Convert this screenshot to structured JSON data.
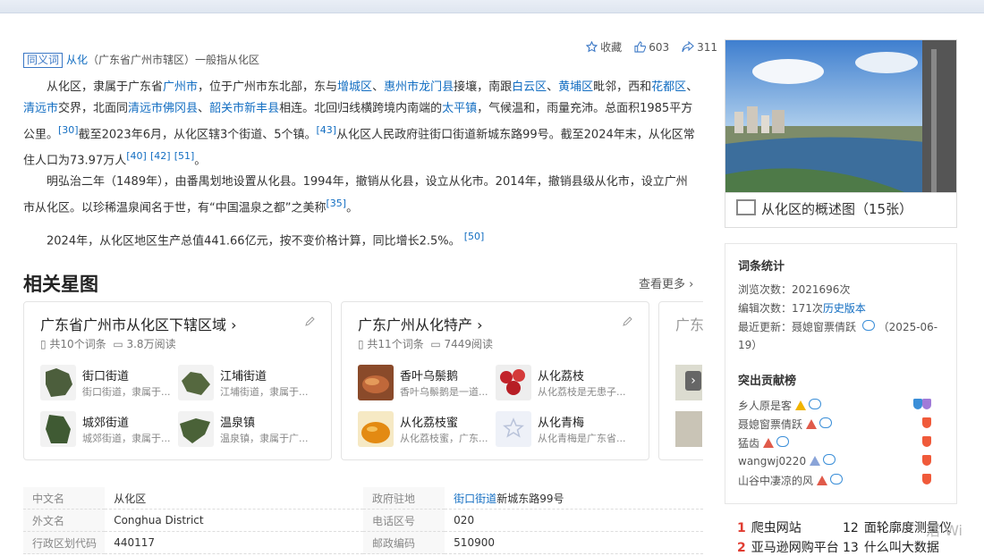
{
  "synonym": {
    "tag": "同义词",
    "link": "从化",
    "rest": "（广东省广州市辖区）一般指从化区"
  },
  "actions": {
    "collect": "收藏",
    "likes": "603",
    "shares": "311"
  },
  "paragraphs": {
    "p1_a": "从化区，隶属于广东省",
    "p1_link1": "广州市",
    "p1_b": "，位于广州市东北部，东与",
    "p1_link2": "增城区",
    "p1_c": "、",
    "p1_link3": "惠州市龙门县",
    "p1_d": "接壤，南跟",
    "p1_link4": "白云区",
    "p1_e": "、",
    "p1_link5": "黄埔区",
    "p1_f": "毗邻，西和",
    "p1_link6": "花都区",
    "p1_g": "、",
    "p1_link7": "清远市",
    "p1_h": "交界，北面同",
    "p1_link8": "清远市佛冈县",
    "p1_i": "、",
    "p1_link9": "韶关市新丰县",
    "p1_j": "相连。北回归线横跨境内南端的",
    "p1_link10": "太平镇",
    "p1_k": "，气候温和，雨量充沛。总面积1985平方公里。",
    "p1_sup1": "[30]",
    "p1_l": "截至2023年6月，从化区辖3个街道、5个镇。",
    "p1_sup2": "[43]",
    "p1_m": "从化区人民政府驻街口街道新城东路99号。截至2024年末，从化区常住人口为73.97万人",
    "p1_sup3": "[40]",
    "p1_sup4": "[42]",
    "p1_sup5": "[51]",
    "p1_n": "。",
    "p2": "明弘治二年（1489年），由番禺划地设置从化县。1994年，撤销从化县，设立从化市。2014年，撤销县级从化市，设立广州市从化区。以珍稀温泉闻名于世，有“中国温泉之都”之美称",
    "p2_sup": "[35]",
    "p2_end": "。",
    "p3": "2024年，从化区地区生产总值441.66亿元，按不变价格计算，同比增长2.5%。",
    "p3_sup": "[50]"
  },
  "star_section": {
    "title": "相关星图",
    "more": "查看更多"
  },
  "cards": [
    {
      "title": "广东省广州市从化区下辖区域",
      "count": "共10个词条",
      "reads": "3.8万阅读",
      "entries": [
        {
          "title": "街口街道",
          "desc": "街口街道，隶属于..."
        },
        {
          "title": "江埔街道",
          "desc": "江埔街道，隶属于..."
        },
        {
          "title": "城郊街道",
          "desc": "城郊街道，隶属于..."
        },
        {
          "title": "温泉镇",
          "desc": "温泉镇，隶属于广..."
        }
      ]
    },
    {
      "title": "广东广州从化特产",
      "count": "共11个词条",
      "reads": "7449阅读",
      "entries": [
        {
          "title": "香叶乌鬃鹅",
          "desc": "香叶乌鬃鹅是一道..."
        },
        {
          "title": "从化荔枝",
          "desc": "从化荔枝是无患子..."
        },
        {
          "title": "从化荔枝蜜",
          "desc": "从化荔枝蜜，广东..."
        },
        {
          "title": "从化青梅",
          "desc": "从化青梅是广东省..."
        }
      ]
    },
    {
      "title": "广东"
    }
  ],
  "info_table": [
    {
      "k1": "中文名",
      "v1": "从化区",
      "k2": "政府驻地",
      "v2_link": "街口街道",
      "v2": "新城东路99号"
    },
    {
      "k1": "外文名",
      "v1": "Conghua District",
      "k2": "电话区号",
      "v2_link": "",
      "v2": "020"
    },
    {
      "k1": "行政区划代码",
      "v1": "440117",
      "k2": "邮政编码",
      "v2_link": "",
      "v2": "510900"
    }
  ],
  "side": {
    "photo_caption": "从化区的概述图（15张）",
    "stats_title": "词条统计",
    "views": "浏览次数：2021696次",
    "edits_prefix": "编辑次数：171次",
    "edits_link": "历史版本",
    "updated": "最近更新：聂媳窗票倩跃",
    "updated_date": "（2025-06-19）",
    "contrib_title": "突出贡献榜",
    "contributors": [
      "乡人原是客",
      "聂媳窗票倩跃",
      "猛齿",
      "wangwj0220",
      "山谷中凄凉的风"
    ]
  },
  "hot": [
    {
      "n": "1",
      "t": "爬虫网站"
    },
    {
      "n": "12",
      "t": "面轮廓度测量仪"
    },
    {
      "n": "2",
      "t": "亚马逊网购平台"
    },
    {
      "n": "13",
      "t": "什么叫大数据"
    }
  ],
  "watermark": "活 Wi"
}
